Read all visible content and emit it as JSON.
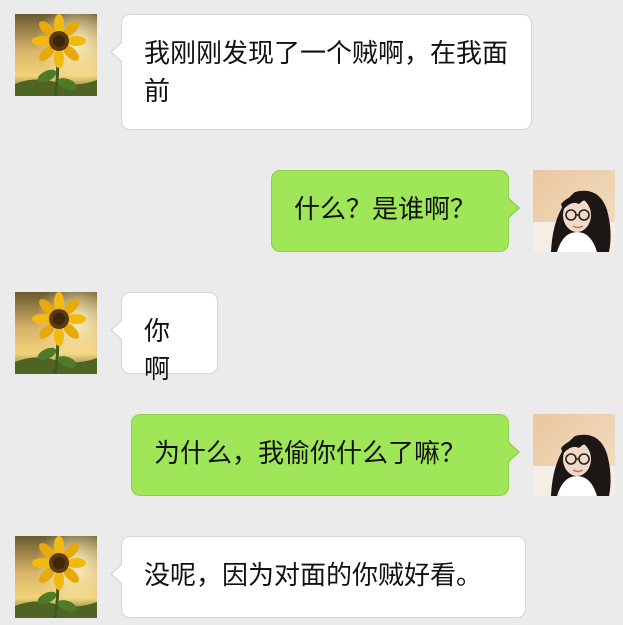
{
  "colors": {
    "background": "#ebebeb",
    "incoming_bubble": "#ffffff",
    "outgoing_bubble": "#9fe658"
  },
  "avatars": {
    "contact": "sunflower-avatar",
    "self": "girl-with-glasses-avatar"
  },
  "messages": [
    {
      "side": "left",
      "text": "我刚刚发现了一个贼啊，在我面前"
    },
    {
      "side": "right",
      "text": "什么？是谁啊？"
    },
    {
      "side": "left",
      "text": "你啊"
    },
    {
      "side": "right",
      "text": "为什么，我偷你什么了嘛？"
    },
    {
      "side": "left",
      "text": "没呢，因为对面的你贼好看。"
    }
  ]
}
